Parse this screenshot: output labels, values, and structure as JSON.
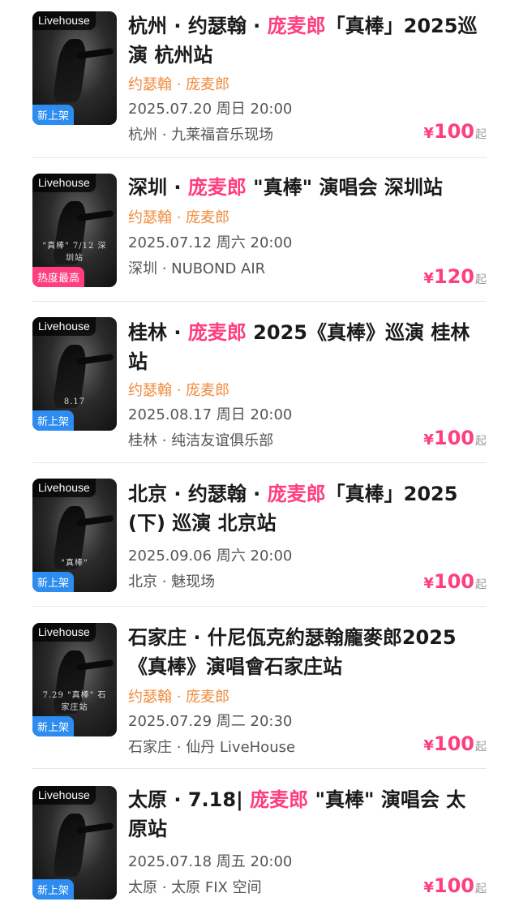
{
  "events": [
    {
      "badge": "Livehouse",
      "tag": "新上架",
      "title_pre": "杭州 · 约瑟翰 · ",
      "title_hl": "庞麦郎",
      "title_post": "「真棒」2025巡演 杭州站",
      "artist": "约瑟翰 · 庞麦郎",
      "date": "2025.07.20 周日 20:00",
      "venue": "杭州 · 九莱福音乐现场",
      "price": "100",
      "poster_text": ""
    },
    {
      "badge": "Livehouse",
      "tag": "热度最高",
      "title_pre": "深圳 · ",
      "title_hl": "庞麦郎",
      "title_post": " \"真棒\" 演唱会 深圳站",
      "artist": "约瑟翰 · 庞麦郎",
      "date": "2025.07.12 周六 20:00",
      "venue": "深圳 · NUBOND AIR",
      "price": "120",
      "poster_text": "\"真棒\" 7/12 深圳站"
    },
    {
      "badge": "Livehouse",
      "tag": "新上架",
      "title_pre": "桂林 · ",
      "title_hl": "庞麦郎",
      "title_post": " 2025《真棒》巡演 桂林站",
      "artist": "约瑟翰 · 庞麦郎",
      "date": "2025.08.17 周日 20:00",
      "venue": "桂林 · 纯洁友谊俱乐部",
      "price": "100",
      "poster_text": "8.17"
    },
    {
      "badge": "Livehouse",
      "tag": "新上架",
      "title_pre": "北京 · 约瑟翰 · ",
      "title_hl": "庞麦郎",
      "title_post": "「真棒」2025 (下) 巡演 北京站",
      "artist": "",
      "date": "2025.09.06 周六 20:00",
      "venue": "北京 · 魅现场",
      "price": "100",
      "poster_text": "\"真棒\""
    },
    {
      "badge": "Livehouse",
      "tag": "新上架",
      "title_pre": "石家庄 · 什尼佤克約瑟翰龐麥郎2025《真棒》演唱會石家庄站",
      "title_hl": "",
      "title_post": "",
      "artist": "约瑟翰 · 庞麦郎",
      "date": "2025.07.29 周二 20:30",
      "venue": "石家庄 · 仙丹 LiveHouse",
      "price": "100",
      "poster_text": "7.29 \"真棒\" 石家庄站"
    },
    {
      "badge": "Livehouse",
      "tag": "新上架",
      "title_pre": "太原 · 7.18| ",
      "title_hl": "庞麦郎",
      "title_post": " \"真棒\" 演唱会 太原站",
      "artist": "",
      "date": "2025.07.18 周五 20:00",
      "venue": "太原 · 太原 FIX 空间",
      "price": "100",
      "poster_text": ""
    }
  ],
  "currency": "¥",
  "price_suffix": "起",
  "colors": {
    "accent": "#ff3d7f",
    "artist": "#f08a3c",
    "new_tag": "#2d8cf0",
    "hot_tag": "#ff3d7f"
  }
}
